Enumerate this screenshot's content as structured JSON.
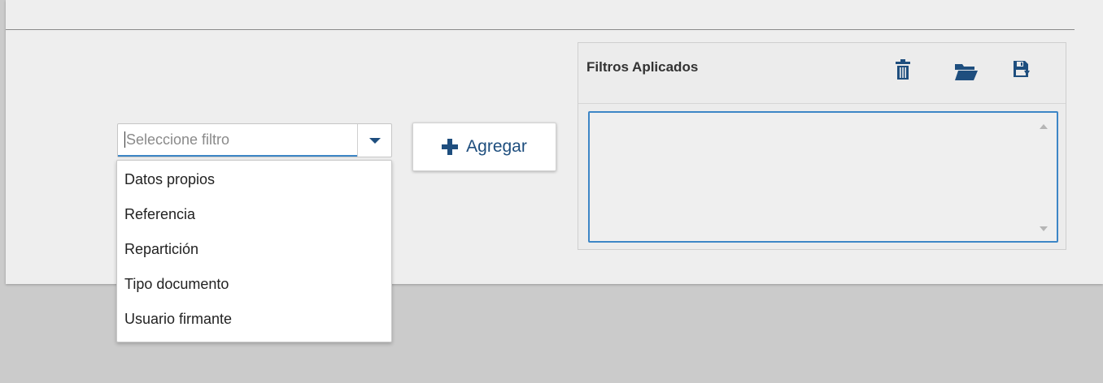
{
  "filter_select": {
    "placeholder": "Seleccione filtro",
    "options": [
      "Datos propios",
      "Referencia",
      "Repartición",
      "Tipo documento",
      "Usuario firmante"
    ]
  },
  "add_button": {
    "label": "Agregar",
    "icon": "plus-icon"
  },
  "applied_filters": {
    "title": "Filtros Aplicados",
    "icons": [
      "trash-icon",
      "folder-open-icon",
      "save-icon"
    ],
    "value": ""
  },
  "colors": {
    "accent": "#1e4e7e",
    "focus_border": "#3d86c6",
    "panel_bg": "#eeeeee",
    "page_bg": "#cbcbcb"
  }
}
